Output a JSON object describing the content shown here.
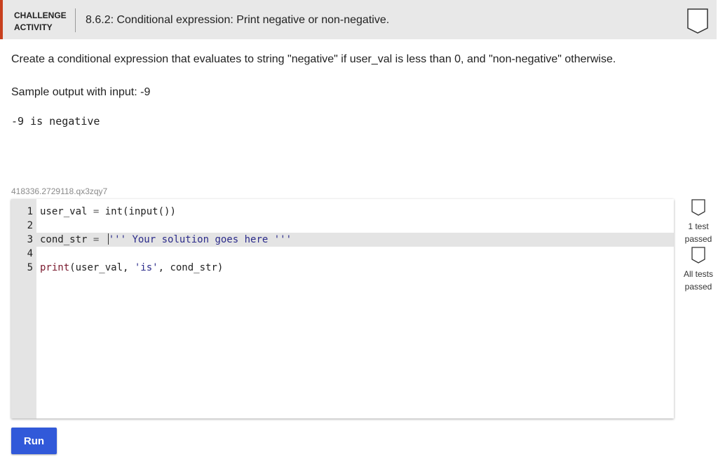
{
  "header": {
    "label_line1": "CHALLENGE",
    "label_line2": "ACTIVITY",
    "title": "8.6.2: Conditional expression: Print negative or non-negative."
  },
  "description": "Create a conditional expression that evaluates to string \"negative\" if user_val is less than 0, and \"non-negative\" otherwise.",
  "sample_label": "Sample output with input: -9",
  "sample_output": "-9 is negative",
  "build_id": "418336.2729118.qx3zqy7",
  "code": {
    "line_numbers": [
      "1",
      "2",
      "3",
      "4",
      "5"
    ],
    "line1": {
      "a": "user_val",
      "b": " = ",
      "c": "int(input())"
    },
    "line3": {
      "a": "cond_str",
      "b": " = ",
      "c": "''' Your solution goes here '''"
    },
    "line5": {
      "a": "print",
      "b": "(user_val, ",
      "c": "'is'",
      "d": ", cond_str)"
    }
  },
  "tests": {
    "test1_line1": "1 test",
    "test1_line2": "passed",
    "test2_line1": "All tests",
    "test2_line2": "passed"
  },
  "run_label": "Run",
  "colors": {
    "accent": "#c8401e",
    "run_button": "#3159d9",
    "string": "#2b2b8a",
    "keyword": "#7a1a2e"
  }
}
